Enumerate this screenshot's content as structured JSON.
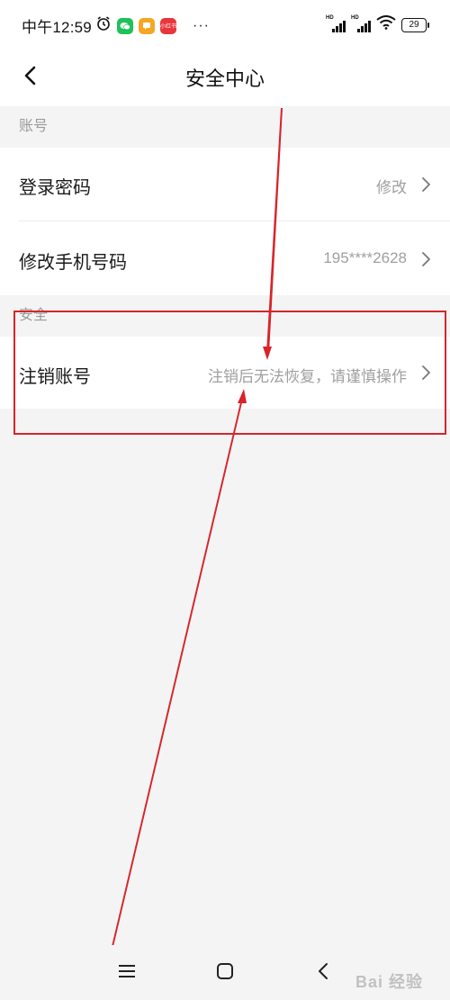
{
  "status_bar": {
    "time": "中午12:59",
    "notification_icons": [
      "alarm-icon",
      "wechat-icon",
      "message-icon",
      "app-icon"
    ],
    "app_icon_text": "小红书",
    "more": "···",
    "signal_label_1": "HD",
    "signal_label_2": "HD",
    "battery": "29"
  },
  "nav": {
    "title": "安全中心",
    "back_icon": "chevron-left-icon"
  },
  "sections": {
    "account": {
      "header": "账号",
      "rows": [
        {
          "label": "登录密码",
          "value": "修改"
        },
        {
          "label": "修改手机号码",
          "value": "195****2628"
        }
      ]
    },
    "security": {
      "header": "安全",
      "rows": [
        {
          "label": "注销账号",
          "value": "注销后无法恢复，请谨慎操作"
        }
      ]
    }
  },
  "bottom_nav": {
    "icons": [
      "menu-icon",
      "home-square-icon",
      "back-chevron-icon"
    ]
  },
  "watermark": "Bai 经验",
  "colors": {
    "annotation_red": "#d8242a",
    "background": "#f4f4f4",
    "secondary_text": "#a0a0a0"
  }
}
